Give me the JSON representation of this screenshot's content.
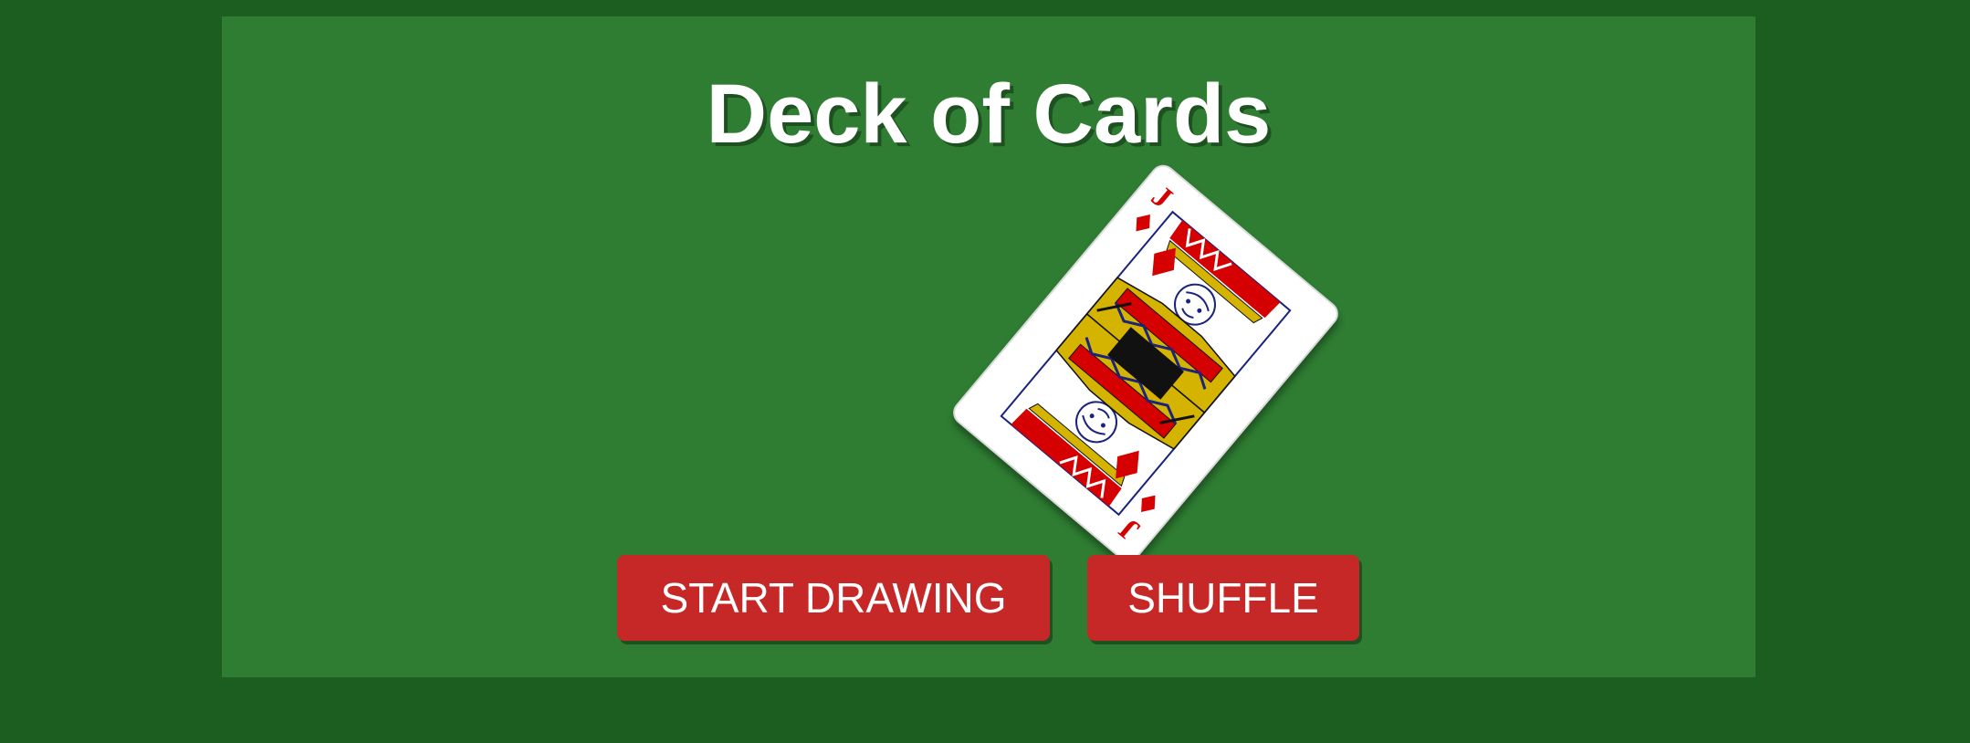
{
  "page": {
    "title": "Deck of Cards"
  },
  "card": {
    "rank": "J",
    "suit": "diamonds",
    "suit_icon": "diamond-icon",
    "suit_color": "#d50000",
    "face_colors": {
      "gold": "#d4b400",
      "navy": "#1a237e",
      "red": "#d50000",
      "black": "#111111"
    }
  },
  "buttons": {
    "start_label": "START DRAWING",
    "shuffle_label": "SHUFFLE"
  },
  "colors": {
    "background": "#1b5e20",
    "table": "#2e7d32",
    "button": "#c62828",
    "text": "#ffffff"
  }
}
